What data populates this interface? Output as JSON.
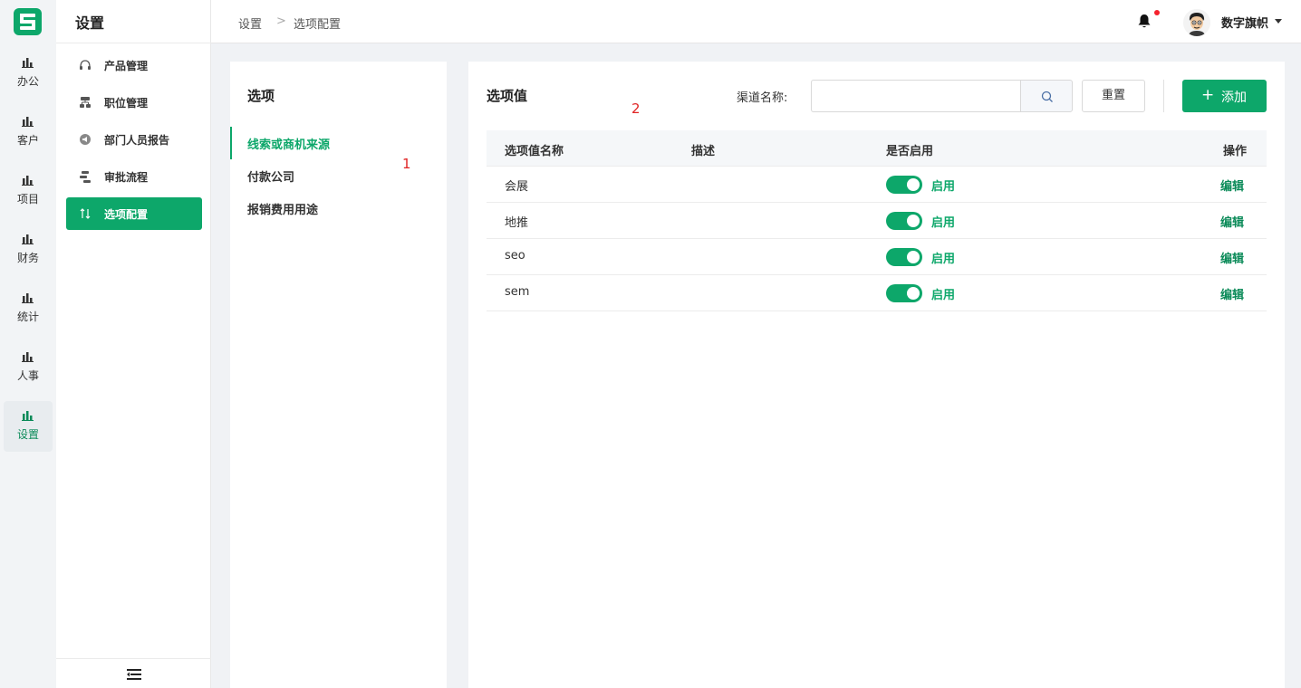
{
  "rail": {
    "items": [
      {
        "label": "办公",
        "icon": "bar-chart-icon"
      },
      {
        "label": "客户",
        "icon": "bar-chart-icon"
      },
      {
        "label": "项目",
        "icon": "bar-chart-icon"
      },
      {
        "label": "财务",
        "icon": "bar-chart-icon"
      },
      {
        "label": "统计",
        "icon": "bar-chart-icon"
      },
      {
        "label": "人事",
        "icon": "bar-chart-icon"
      },
      {
        "label": "设置",
        "icon": "bar-chart-icon"
      }
    ],
    "active_index": 6
  },
  "submenu": {
    "title": "设置",
    "items": [
      {
        "label": "产品管理",
        "icon": "headset-icon"
      },
      {
        "label": "职位管理",
        "icon": "hierarchy-icon"
      },
      {
        "label": "部门人员报告",
        "icon": "megaphone-icon"
      },
      {
        "label": "审批流程",
        "icon": "flow-icon"
      },
      {
        "label": "选项配置",
        "icon": "swap-icon"
      }
    ],
    "active_index": 4
  },
  "header": {
    "breadcrumb": [
      "设置",
      "选项配置"
    ],
    "breadcrumb_separator": ">",
    "username": "数字旗帜",
    "has_notification": true
  },
  "options": {
    "title": "选项",
    "items": [
      "线索或商机来源",
      "付款公司",
      "报销费用用途"
    ],
    "active_index": 0,
    "annotation": "1"
  },
  "values": {
    "title": "选项值",
    "annotation": "2",
    "filter_label": "渠道名称:",
    "search_value": "",
    "reset_label": "重置",
    "add_label": "添加",
    "columns": [
      "选项值名称",
      "描述",
      "是否启用",
      "操作"
    ],
    "rows": [
      {
        "name": "会展",
        "desc": "",
        "enabled": true,
        "status": "启用",
        "action": "编辑"
      },
      {
        "name": "地推",
        "desc": "",
        "enabled": true,
        "status": "启用",
        "action": "编辑"
      },
      {
        "name": "seo",
        "desc": "",
        "enabled": true,
        "status": "启用",
        "action": "编辑"
      },
      {
        "name": "sem",
        "desc": "",
        "enabled": true,
        "status": "启用",
        "action": "编辑"
      }
    ]
  },
  "colors": {
    "primary": "#0da76a",
    "annotation": "#e02424",
    "notification_dot": "#f5222d"
  }
}
